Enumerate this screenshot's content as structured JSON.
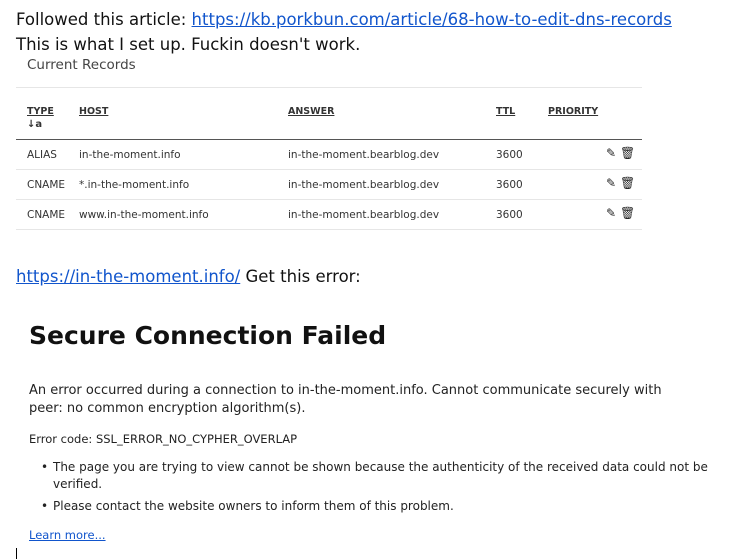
{
  "intro": {
    "line1_prefix": "Followed this article:",
    "article_link": "https://kb.porkbun.com/article/68-how-to-edit-dns-records",
    "line2": "This is what I set up.  Fuckin doesn't work."
  },
  "dns_table": {
    "title": "Current Records",
    "columns": [
      "TYPE",
      "HOST",
      "ANSWER",
      "TTL",
      "PRIORITY"
    ],
    "sort_icon": "↓a",
    "rows": [
      {
        "type": "ALIAS",
        "host": "in-the-moment.info",
        "answer": "in-the-moment.bearblog.dev",
        "ttl": "3600",
        "priority": ""
      },
      {
        "type": "CNAME",
        "host": "*.in-the-moment.info",
        "answer": "in-the-moment.bearblog.dev",
        "ttl": "3600",
        "priority": ""
      },
      {
        "type": "CNAME",
        "host": "www.in-the-moment.info",
        "answer": "in-the-moment.bearblog.dev",
        "ttl": "3600",
        "priority": ""
      }
    ],
    "edit_icon": "pencil-icon",
    "delete_icon": "trash-icon"
  },
  "site": {
    "link": "https://in-the-moment.info/",
    "suffix": " Get this error:"
  },
  "error": {
    "title": "Secure Connection Failed",
    "message_line1": "An error occurred during a connection to in-the-moment.info. Cannot communicate securely with",
    "message_line2": "peer: no common encryption algorithm(s).",
    "code_line": "Error code: SSL_ERROR_NO_CYPHER_OVERLAP",
    "bullets": [
      {
        "line1": "The page you are trying to view cannot be shown because the authenticity of the received data could not be",
        "line2": "verified."
      },
      {
        "line1": "Please contact the website owners to inform them of this problem.",
        "line2": ""
      }
    ],
    "learn_more": "Learn more..."
  },
  "colors": {
    "link": "#1155cc",
    "rule": "#e6e6e6"
  }
}
